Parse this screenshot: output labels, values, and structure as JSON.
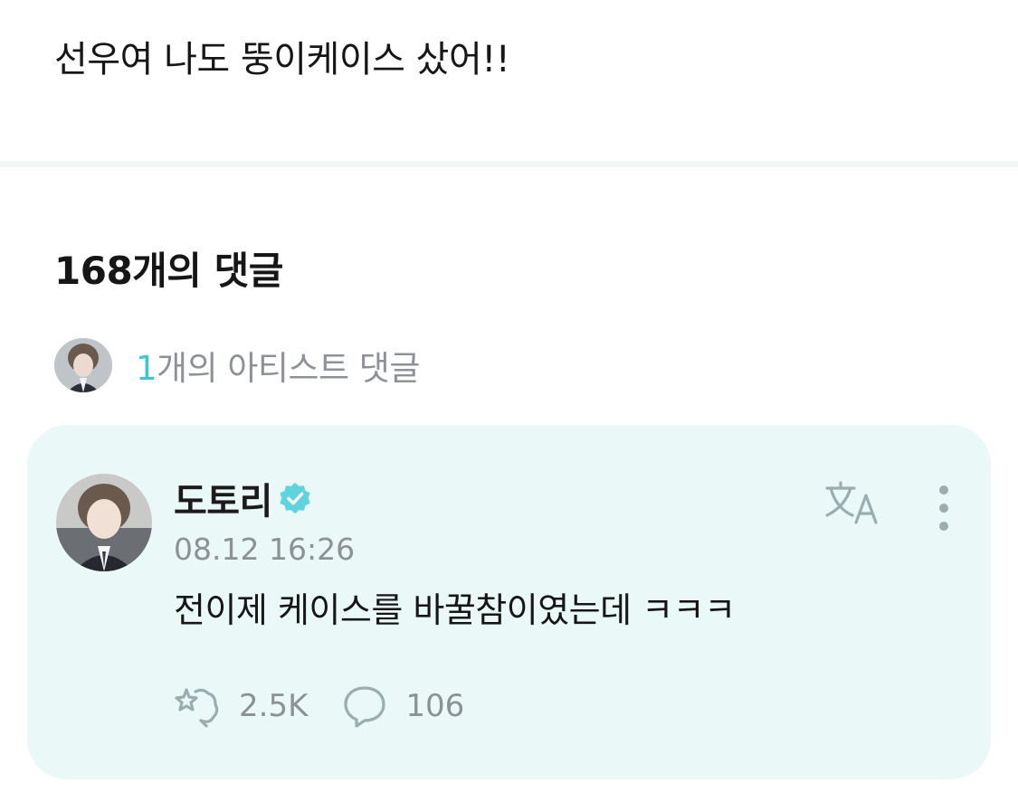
{
  "post": {
    "text": "선우여 나도 뚱이케이스 샀어!!"
  },
  "comments": {
    "title": "168개의 댓글",
    "artist_count": "1",
    "artist_label": "개의 아티스트 댓글"
  },
  "comment": {
    "author": "도토리",
    "verified": true,
    "date": "08.12 16:26",
    "text": "전이제 케이스를 바꿀참이였는데 ㅋㅋㅋ",
    "likes": "2.5K",
    "replies": "106",
    "icons": [
      "verified-icon",
      "translate-icon",
      "more-icon",
      "like-icon",
      "reply-icon"
    ]
  },
  "colors": {
    "accent": "#3fc6cf",
    "card_bg": "#eaf9f7",
    "muted_text": "#8c9196",
    "icon": "#9aaeb0"
  }
}
